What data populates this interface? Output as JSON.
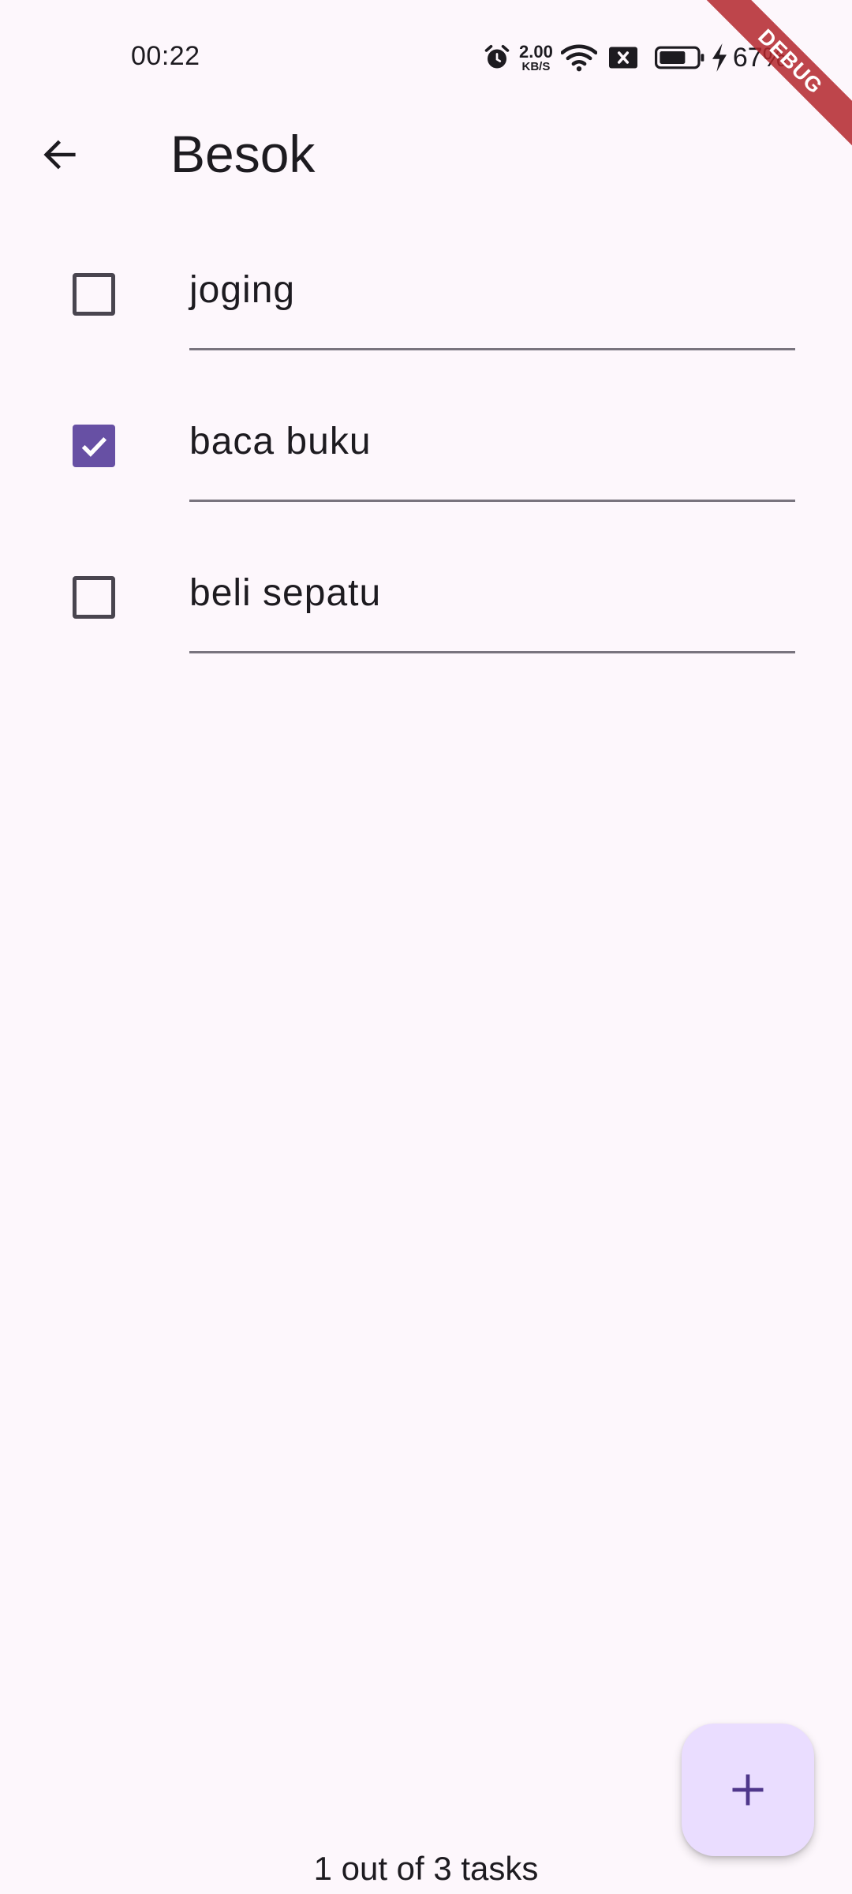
{
  "status_bar": {
    "time": "00:22",
    "net_speed_value": "2.00",
    "net_speed_unit": "KB/S",
    "battery_percent": "67%",
    "icons": [
      "alarm-icon",
      "wifi-icon",
      "sim-blocked-icon",
      "battery-icon",
      "charging-icon"
    ]
  },
  "debug_banner": "DEBUG",
  "app_bar": {
    "title": "Besok",
    "back_icon": "arrow-back-icon"
  },
  "tasks": [
    {
      "text": "joging",
      "done": false
    },
    {
      "text": "baca buku",
      "done": true
    },
    {
      "text": "beli sepatu",
      "done": false
    }
  ],
  "fab_icon": "add-icon",
  "footer": {
    "task_count": "1 out of 3 tasks"
  },
  "colors": {
    "background": "#fdf7fc",
    "primary": "#6750a4",
    "fab_container": "#eaddff",
    "on_surface": "#1d1b20",
    "outline": "#79747e"
  }
}
